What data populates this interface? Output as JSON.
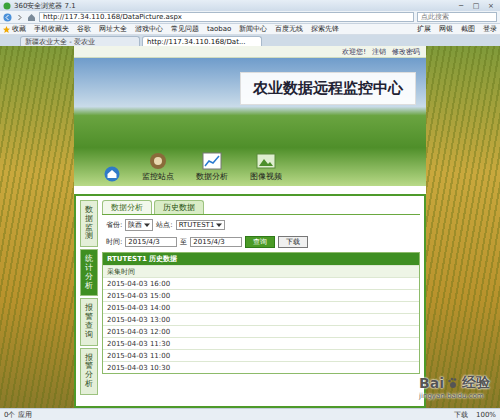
{
  "window": {
    "title": "360安全浏览器 7.1",
    "controls": [
      "─",
      "□",
      "×"
    ]
  },
  "address_bar": {
    "url": "http://117.34.110.168/DataPicture.aspx",
    "search_placeholder": "点此搜索"
  },
  "bookmarks": [
    "收藏",
    "手机收藏夹",
    "谷歌",
    "网址大全",
    "游戏中心",
    "常见问题",
    "taobao",
    "新闻中心",
    "百度无线",
    "探索先锋"
  ],
  "extensions": [
    "扩展",
    "网银",
    "截图",
    "登录"
  ],
  "tabs": [
    {
      "label": "新疆农业大全 - 爱农业",
      "selected": false
    },
    {
      "label": "http://117.34.110.168/Dat...",
      "selected": true
    }
  ],
  "page": {
    "top_links": [
      "欢迎您!",
      "注销",
      "修改密码"
    ],
    "title": "农业数据远程监控中心",
    "nav": [
      {
        "label": "监控站点"
      },
      {
        "label": "数据分析"
      },
      {
        "label": "图像视频"
      }
    ],
    "side_menu": [
      {
        "label": "数据监测",
        "selected": false
      },
      {
        "label": "统计分析",
        "selected": true
      },
      {
        "label": "报警查询",
        "selected": false
      },
      {
        "label": "报警分析",
        "selected": false
      }
    ],
    "breadcrumb": [
      {
        "label": "数据分析",
        "selected": false
      },
      {
        "label": "历史数据",
        "selected": true
      }
    ],
    "form": {
      "province_label": "省份:",
      "province": "陕西",
      "station_label": "站点:",
      "station": "RTUTEST1",
      "time_label": "时间:",
      "from": "2015/4/3",
      "to_label": "至",
      "to": "2015/4/3",
      "buttons": [
        "查询",
        "下载"
      ]
    },
    "table": {
      "title": "RTUTEST1 历史数据",
      "columns": [
        "采集时间"
      ],
      "rows": [
        "2015-04-03 16:00",
        "2015-04-03 15:00",
        "2015-04-03 14:00",
        "2015-04-03 13:00",
        "2015-04-03 12:00",
        "2015-04-03 11:30",
        "2015-04-03 11:00",
        "2015-04-03 10:30"
      ]
    }
  },
  "watermark": {
    "brand": "Bai",
    "product": "经验",
    "site": "jingyan.baidu.com"
  },
  "status_bar": {
    "left": "0个 应用",
    "right": [
      "下载",
      "100%"
    ]
  }
}
